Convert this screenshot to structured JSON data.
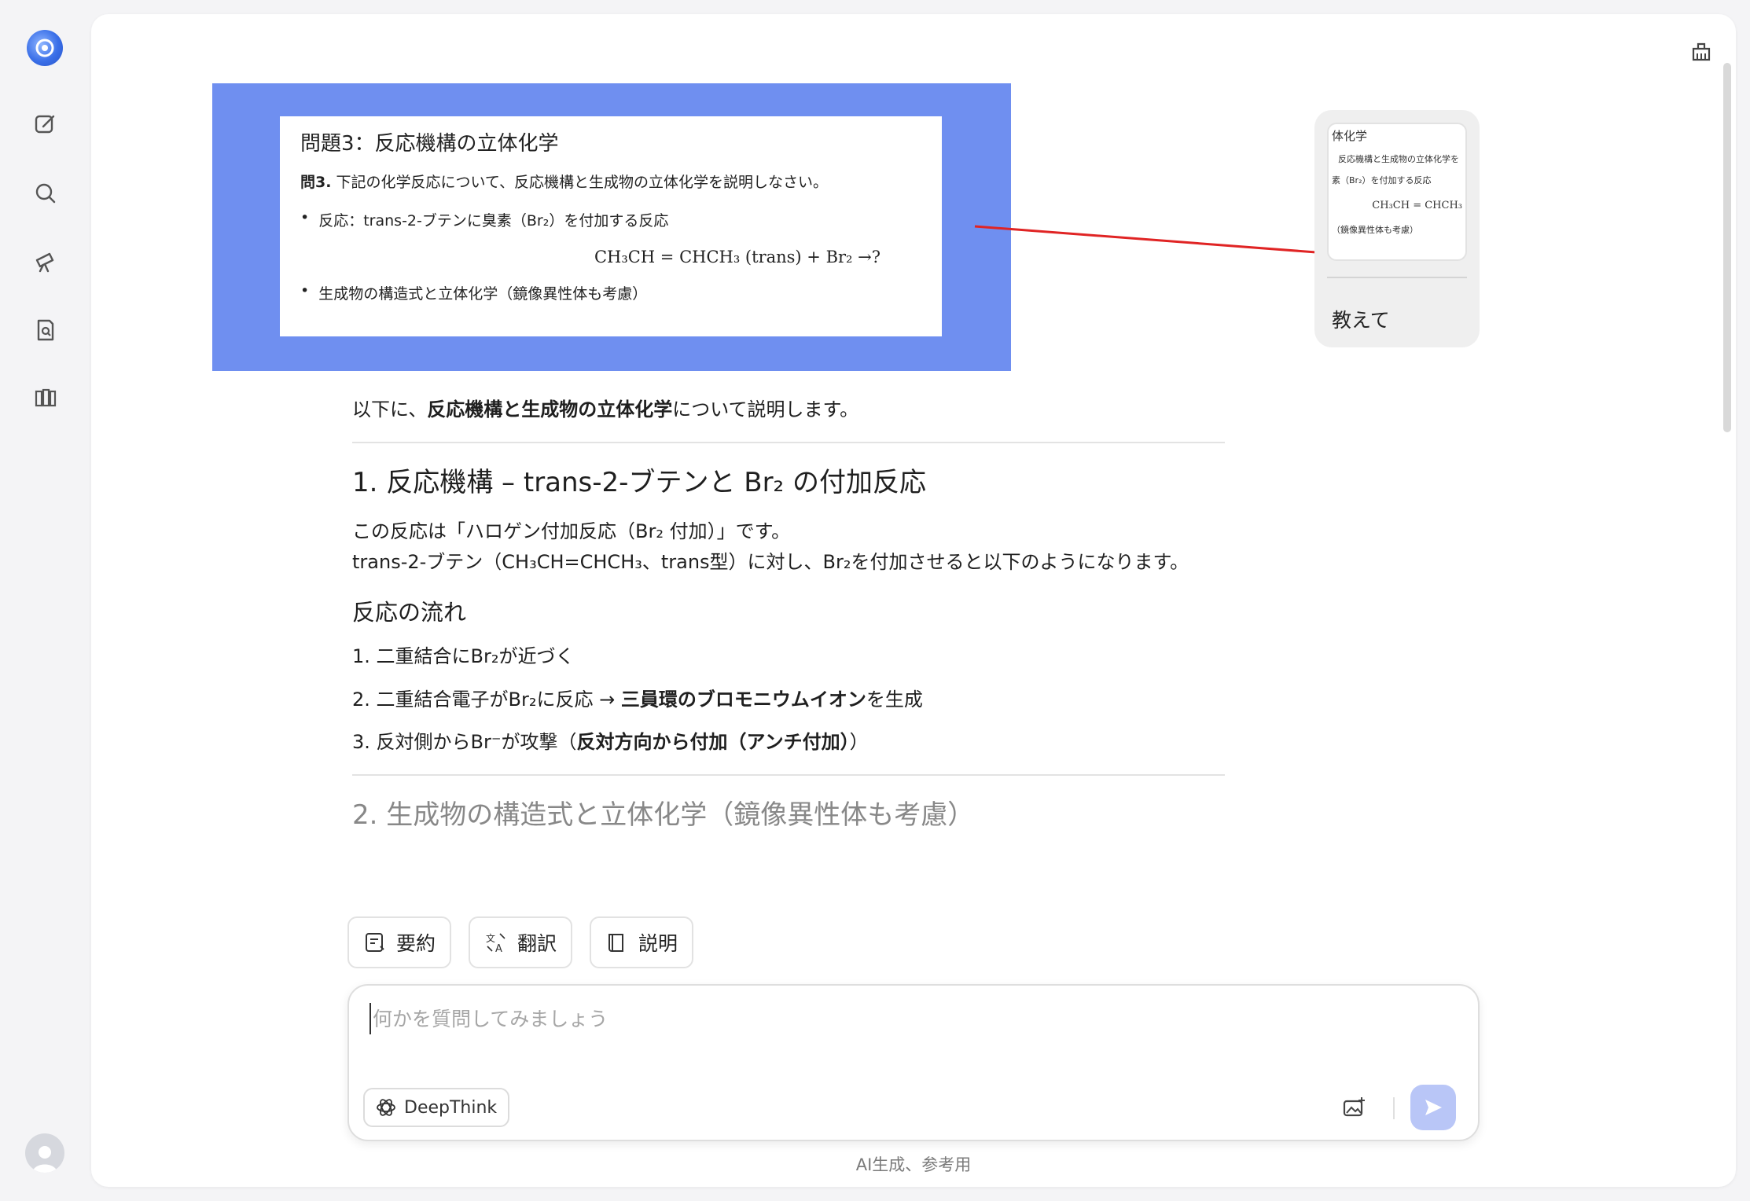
{
  "screenshot": {
    "title": "問題3：反応機構の立体化学",
    "question_bold": "問3.",
    "question_rest": " 下記の化学反応について、反応機構と生成物の立体化学を説明しなさい。",
    "bullet1": "反応：trans-2-ブテンに臭素（Br₂）を付加する反応",
    "equation": "CH₃CH = CHCH₃ (trans) + Br₂ →?",
    "bullet2": "生成物の構造式と立体化学（鏡像異性体も考慮）"
  },
  "user_bubble": {
    "thumb_line1": "体化学",
    "thumb_line2": "反応機構と生成物の立体化学を",
    "thumb_line3": "素（Br₂）を付加する反応",
    "thumb_line4": "CH₃CH = CHCH₃",
    "thumb_line5": "（鏡像異性体も考慮）",
    "message": "教えて"
  },
  "answer": {
    "intro_pre": "以下に、",
    "intro_bold": "反応機構と生成物の立体化学",
    "intro_post": "について説明します。",
    "h1": "1. 反応機構 – trans-2-ブテンと Br₂ の付加反応",
    "p1": "この反応は「ハロゲン付加反応（Br₂ 付加）」です。",
    "p2": "trans-2-ブテン（CH₃CH=CHCH₃、trans型）に対し、Br₂を付加させると以下のようになります。",
    "h3": "反応の流れ",
    "step1": "1. 二重結合にBr₂が近づく",
    "step2_pre": "2. 二重結合電子がBr₂に反応 → ",
    "step2_bold": "三員環のブロモニウムイオン",
    "step2_post": "を生成",
    "step3_pre": "3. 反対側からBr⁻が攻撃（",
    "step3_bold": "反対方向から付加（アンチ付加）",
    "step3_post": "）",
    "h2_cut": "2. 生成物の構造式と立体化学（鏡像異性体も考慮）"
  },
  "actions": {
    "summarize": "要約",
    "translate": "翻訳",
    "explain": "説明"
  },
  "composer": {
    "placeholder": "何かを質問してみましょう",
    "deepthink": "DeepThink"
  },
  "footer_note": "AI生成、参考用",
  "icons": {
    "rail": [
      "logo-icon",
      "new-chat-icon",
      "search-icon",
      "telescope-icon",
      "document-search-icon",
      "library-icon"
    ],
    "clear": "clear-broom-icon",
    "image_upload": "image-upload-icon",
    "send": "send-icon"
  },
  "colors": {
    "accent_blue": "#6f8ff0",
    "send_disabled": "#b9c6f7",
    "annotation_arrow": "#e02424"
  }
}
